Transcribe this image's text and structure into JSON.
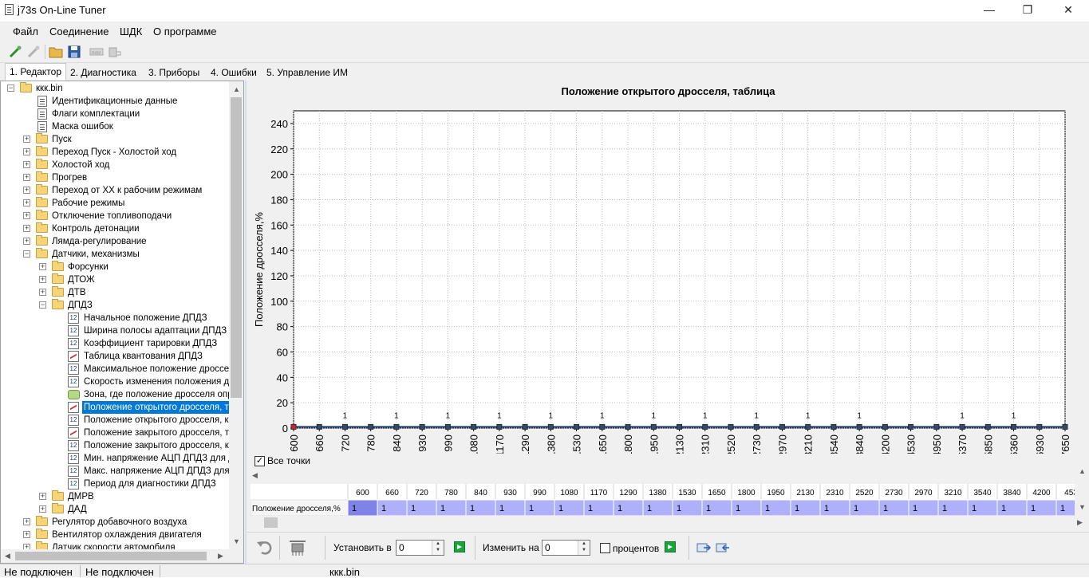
{
  "window": {
    "title": "j73s On-Line Tuner",
    "min_icon": "minimize-icon",
    "max_icon": "maximize-icon",
    "close_icon": "close-icon"
  },
  "menu": [
    "Файл",
    "Соединение",
    "ШДК",
    "О программе"
  ],
  "toolbar": [
    "connect-icon",
    "disconnect-icon",
    "open-folder-icon",
    "save-icon",
    "ram-icon",
    "flash-icon"
  ],
  "tabs": [
    "1. Редактор",
    "2. Диагностика",
    "3. Приборы",
    "4. Ошибки",
    "5. Управление ИМ"
  ],
  "tree": {
    "root": "ккк.bin",
    "items": [
      {
        "label": "Идентификационные данные",
        "icon": "document-icon"
      },
      {
        "label": "Флаги комплектации",
        "icon": "document-icon"
      },
      {
        "label": "Маска ошибок",
        "icon": "document-icon"
      },
      {
        "label": "Пуск",
        "icon": "folder-icon"
      },
      {
        "label": "Переход Пуск - Холостой ход",
        "icon": "folder-icon"
      },
      {
        "label": "Холостой ход",
        "icon": "folder-icon"
      },
      {
        "label": "Прогрев",
        "icon": "folder-icon"
      },
      {
        "label": "Переход от ХХ к рабочим режимам",
        "icon": "folder-icon"
      },
      {
        "label": "Рабочие режимы",
        "icon": "folder-icon"
      },
      {
        "label": "Отключение топливоподачи",
        "icon": "folder-icon"
      },
      {
        "label": "Контроль детонации",
        "icon": "folder-icon"
      },
      {
        "label": "Лямда-регулирование",
        "icon": "folder-icon"
      },
      {
        "label": "Датчики, механизмы",
        "icon": "folder-open-icon"
      },
      {
        "label": "Форсунки",
        "icon": "folder-icon"
      },
      {
        "label": "ДТОЖ",
        "icon": "folder-icon"
      },
      {
        "label": "ДТВ",
        "icon": "folder-icon"
      },
      {
        "label": "ДПДЗ",
        "icon": "folder-open-icon"
      },
      {
        "label": "Начальное положение ДПДЗ",
        "icon": "number-icon"
      },
      {
        "label": "Ширина полосы адаптации ДПДЗ",
        "icon": "number-icon"
      },
      {
        "label": "Коэффициент тарировки ДПДЗ",
        "icon": "number-icon"
      },
      {
        "label": "Таблица квантования ДПДЗ",
        "icon": "chart-icon"
      },
      {
        "label": "Максимальное положение дросселя",
        "icon": "number-icon"
      },
      {
        "label": "Скорость изменения положения дро",
        "icon": "number-icon"
      },
      {
        "label": "Зона, где положение дросселя опре,",
        "icon": "zone-icon"
      },
      {
        "label": "Положение открытого дросселя, таб",
        "icon": "chart-icon"
      },
      {
        "label": "Положение открытого дросселя, кон",
        "icon": "number-icon"
      },
      {
        "label": "Положение закрытого дросселя, таб",
        "icon": "chart-icon"
      },
      {
        "label": "Положение закрытого дросселя, кон",
        "icon": "number-icon"
      },
      {
        "label": "Мин. напряжение АЦП ДПДЗ для ди",
        "icon": "number-icon"
      },
      {
        "label": "Макс. напряжение АЦП ДПДЗ для д",
        "icon": "number-icon"
      },
      {
        "label": "Период для диагностики ДПДЗ",
        "icon": "number-icon"
      },
      {
        "label": "ДМРВ",
        "icon": "folder-icon"
      },
      {
        "label": "ДАД",
        "icon": "folder-icon"
      },
      {
        "label": "Регулятор добавочного воздуха",
        "icon": "folder-icon"
      },
      {
        "label": "Вентилятор охлаждения двигателя",
        "icon": "folder-icon"
      },
      {
        "label": "Датчик скорости автомобиля",
        "icon": "folder-icon"
      }
    ]
  },
  "chart_data": {
    "type": "line",
    "title": "Положение открытого дросселя, таблица",
    "xlabel": "",
    "ylabel": "Положение дросселя,%",
    "ylim": [
      0,
      250
    ],
    "yticks": [
      0,
      20,
      40,
      60,
      80,
      100,
      120,
      140,
      160,
      180,
      200,
      220,
      240
    ],
    "grid": true,
    "x": [
      600,
      660,
      720,
      780,
      840,
      930,
      990,
      1080,
      1170,
      1290,
      1380,
      1530,
      1650,
      1800,
      1950,
      2130,
      2310,
      2520,
      2730,
      2970,
      3210,
      3540,
      3840,
      4200,
      4530,
      4950,
      5370,
      5850,
      6360,
      6930,
      7650
    ],
    "values": [
      1,
      1,
      1,
      1,
      1,
      1,
      1,
      1,
      1,
      1,
      1,
      1,
      1,
      1,
      1,
      1,
      1,
      1,
      1,
      1,
      1,
      1,
      1,
      1,
      1,
      1,
      1,
      1,
      1,
      1,
      1
    ],
    "point_labels": [
      "",
      "",
      "1",
      "",
      "1",
      "",
      "1",
      "",
      "1",
      "",
      "1",
      "",
      "1",
      "",
      "1",
      "",
      "1",
      "",
      "1",
      "",
      "1",
      "",
      "1",
      "",
      "",
      "",
      "1",
      "",
      "1",
      "",
      ""
    ]
  },
  "all_points": {
    "label": "Все точки",
    "checked": true
  },
  "table": {
    "row_label": "Положение дросселя,%",
    "headers": [
      "600",
      "660",
      "720",
      "780",
      "840",
      "930",
      "990",
      "1080",
      "1170",
      "1290",
      "1380",
      "1530",
      "1650",
      "1800",
      "1950",
      "2130",
      "2310",
      "2520",
      "2730",
      "2970",
      "3210",
      "3540",
      "3840",
      "4200",
      "453"
    ],
    "values": [
      "1",
      "1",
      "1",
      "1",
      "1",
      "1",
      "1",
      "1",
      "1",
      "1",
      "1",
      "1",
      "1",
      "1",
      "1",
      "1",
      "1",
      "1",
      "1",
      "1",
      "1",
      "1",
      "1",
      "1",
      "1"
    ]
  },
  "controls": {
    "set_label": "Установить в",
    "set_value": "0",
    "change_label": "Изменить на",
    "change_value": "0",
    "percent_label": "процентов"
  },
  "status": {
    "left1": "Не подключен",
    "left2": "Не подключен",
    "file": "ккк.bin"
  }
}
